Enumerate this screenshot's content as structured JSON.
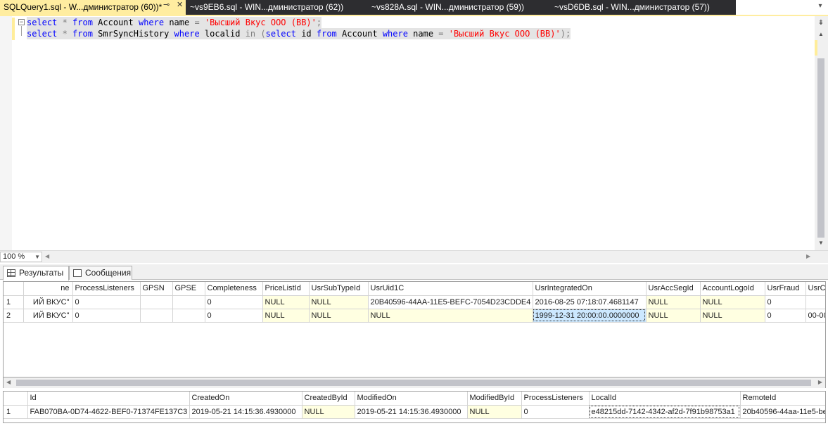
{
  "tabs": [
    {
      "label": "SQLQuery1.sql - W...дминистратор (60))*",
      "active": true
    },
    {
      "label": "~vs9EB6.sql - WIN...дминистратор (62))",
      "active": false
    },
    {
      "label": "~vs828A.sql - WIN...дминистратор (59))",
      "active": false
    },
    {
      "label": "~vsD6DB.sql - WIN...дминистратор (57))",
      "active": false
    }
  ],
  "icons": {
    "pin": "pin-icon",
    "close": "close-icon",
    "dropdown": "chevron-down-icon"
  },
  "editor": {
    "line1": {
      "kw1": "select",
      "star": " * ",
      "kw2": "from",
      "t1": " Account ",
      "kw3": "where",
      "t2": " name ",
      "eq": "=",
      "sp": " ",
      "str": "'Высший Вкус ООО (ВВ)'",
      "end": ";"
    },
    "line2": {
      "kw1": "select",
      "star": " * ",
      "kw2": "from",
      "t1": " SmrSyncHistory ",
      "kw3": "where",
      "t2": " localid ",
      "in": "in",
      "p1": " (",
      "kw4": "select",
      "t3": " id ",
      "kw5": "from",
      "t4": " Account ",
      "kw6": "where",
      "t5": " name ",
      "eq": "=",
      "sp": " ",
      "str": "'Высший Вкус ООО (ВВ)'",
      "end": ");"
    }
  },
  "zoom": {
    "value": "100 %"
  },
  "result_tabs": [
    {
      "label": "Результаты",
      "active": true
    },
    {
      "label": "Сообщения",
      "active": false
    }
  ],
  "grid1": {
    "columns": [
      "",
      "ne",
      "ProcessListeners",
      "GPSN",
      "GPSE",
      "Completeness",
      "PriceListId",
      "UsrSubTypeId",
      "UsrUid1C",
      "UsrIntegratedOn",
      "UsrAccSegId",
      "AccountLogoId",
      "UsrFraud",
      "UsrCo"
    ],
    "rows": [
      [
        "1",
        "ИЙ ВКУС\"",
        "0",
        "",
        "",
        "0",
        "NULL",
        "NULL",
        "20B40596-44AA-11E5-BEFC-7054D23CDDE4",
        "2016-08-25 07:18:07.4681147",
        "NULL",
        "NULL",
        "0",
        ""
      ],
      [
        "2",
        "ИЙ ВКУС\"",
        "0",
        "",
        "",
        "0",
        "NULL",
        "NULL",
        "NULL",
        "1999-12-31 20:00:00.0000000",
        "NULL",
        "NULL",
        "0",
        "00-00"
      ]
    ]
  },
  "grid2": {
    "columns": [
      "",
      "Id",
      "CreatedOn",
      "CreatedById",
      "ModifiedOn",
      "ModifiedById",
      "ProcessListeners",
      "LocalId",
      "RemoteId"
    ],
    "rows": [
      [
        "1",
        "FAB070BA-0D74-4622-BEF0-71374FE137C3",
        "2019-05-21 14:15:36.4930000",
        "NULL",
        "2019-05-21 14:15:36.4930000",
        "NULL",
        "0",
        "e48215dd-7142-4342-af2d-7f91b98753a1",
        "20b40596-44aa-11e5-be"
      ]
    ]
  }
}
